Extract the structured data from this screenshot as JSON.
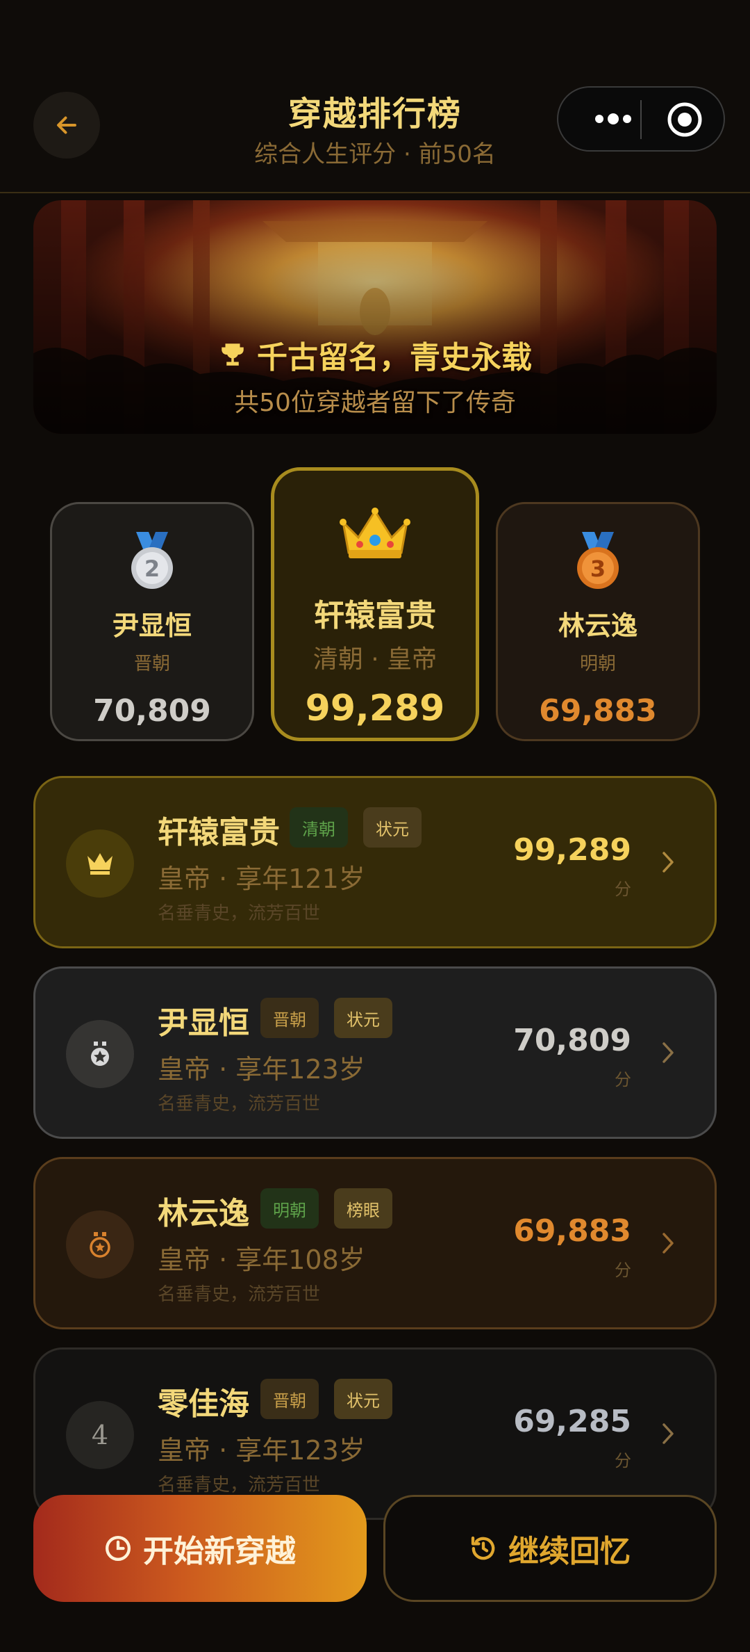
{
  "header": {
    "title": "穿越排行榜",
    "subtitle": "综合人生评分 · 前50名"
  },
  "banner": {
    "title": "千古留名，青史永载",
    "subtitle": "共50位穿越者留下了传奇"
  },
  "podium": [
    {
      "place": 2,
      "name": "尹显恒",
      "era": "晋朝",
      "score": "70,809",
      "icon": "silver-medal-icon"
    },
    {
      "place": 1,
      "name": "轩辕富贵",
      "era": "清朝 · 皇帝",
      "score": "99,289",
      "icon": "crown-icon"
    },
    {
      "place": 3,
      "name": "林云逸",
      "era": "明朝",
      "score": "69,883",
      "icon": "bronze-medal-icon"
    }
  ],
  "list": [
    {
      "rank": "1",
      "name": "轩辕富贵",
      "era": "清朝",
      "title": "状元",
      "meta": "皇帝 · 享年121岁",
      "motto": "名垂青史，流芳百世",
      "score": "99,289",
      "unit": "分"
    },
    {
      "rank": "2",
      "name": "尹显恒",
      "era": "晋朝",
      "title": "状元",
      "meta": "皇帝 · 享年123岁",
      "motto": "名垂青史，流芳百世",
      "score": "70,809",
      "unit": "分"
    },
    {
      "rank": "3",
      "name": "林云逸",
      "era": "明朝",
      "title": "榜眼",
      "meta": "皇帝 · 享年108岁",
      "motto": "名垂青史，流芳百世",
      "score": "69,883",
      "unit": "分"
    },
    {
      "rank": "4",
      "name": "零佳海",
      "era": "晋朝",
      "title": "状元",
      "meta": "皇帝 · 享年123岁",
      "motto": "名垂青史，流芳百世",
      "score": "69,285",
      "unit": "分"
    }
  ],
  "actions": {
    "start": "开始新穿越",
    "continue": "继续回忆"
  },
  "colors": {
    "gold": "#f6d25c",
    "silver": "#cfcdc8",
    "bronze": "#e0892e",
    "background": "#0e0b08"
  }
}
